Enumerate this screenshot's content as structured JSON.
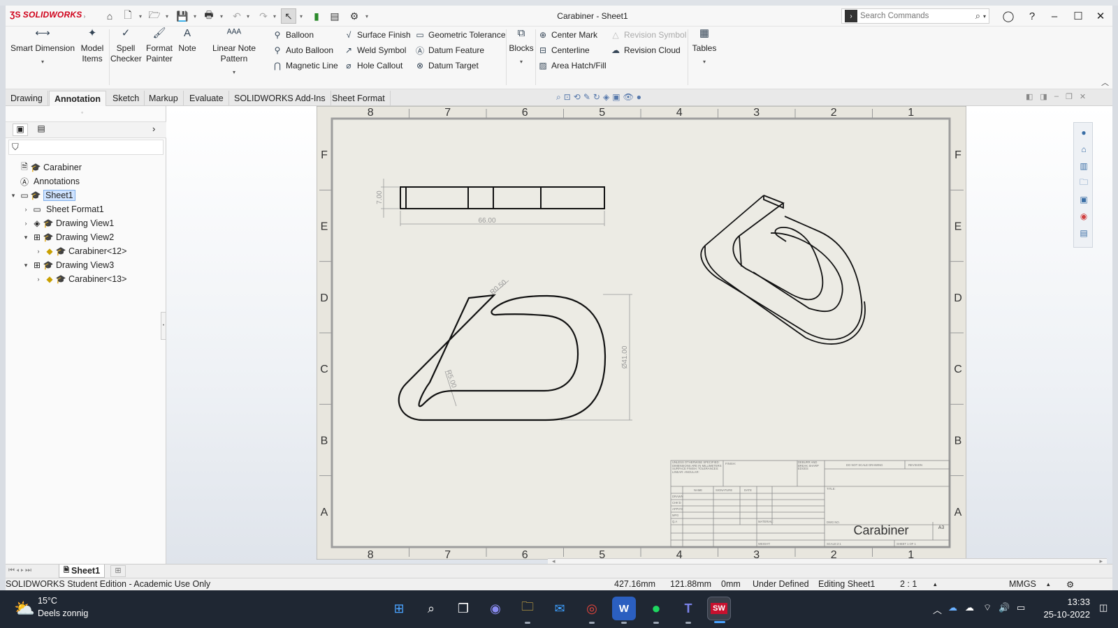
{
  "app": {
    "brand": "SOLIDWORKS",
    "document_title": "Carabiner - Sheet1",
    "accent_color": "#d0021b"
  },
  "search": {
    "placeholder": "Search Commands"
  },
  "ribbon": {
    "smart_dimension": "Smart Dimension",
    "model_items": "Model Items",
    "spell_checker": "Spell Checker",
    "format_painter": "Format Painter",
    "note": "Note",
    "linear_note_pattern": "Linear Note Pattern",
    "balloon": "Balloon",
    "auto_balloon": "Auto Balloon",
    "magnetic_line": "Magnetic Line",
    "surface_finish": "Surface Finish",
    "weld_symbol": "Weld Symbol",
    "hole_callout": "Hole Callout",
    "geometric_tolerance": "Geometric Tolerance",
    "datum_feature": "Datum Feature",
    "datum_target": "Datum Target",
    "blocks": "Blocks",
    "center_mark": "Center Mark",
    "centerline": "Centerline",
    "area_hatch": "Area Hatch/Fill",
    "revision_symbol": "Revision Symbol",
    "revision_cloud": "Revision Cloud",
    "tables": "Tables"
  },
  "tabs": [
    "Drawing",
    "Annotation",
    "Sketch",
    "Markup",
    "Evaluate",
    "SOLIDWORKS Add-Ins",
    "Sheet Format"
  ],
  "active_tab": "Annotation",
  "tree": {
    "root": "Carabiner",
    "annotations": "Annotations",
    "sheet1": "Sheet1",
    "sheet_format": "Sheet Format1",
    "view1": "Drawing View1",
    "view2": "Drawing View2",
    "view2_comp": "Carabiner<12>",
    "view3": "Drawing View3",
    "view3_comp": "Carabiner<13>"
  },
  "drawing": {
    "zone_numbers": [
      "8",
      "7",
      "6",
      "5",
      "4",
      "3",
      "2",
      "1"
    ],
    "zone_letters": [
      "F",
      "E",
      "D",
      "C",
      "B",
      "A"
    ],
    "dims": {
      "height": "7.00",
      "length": "66.00",
      "radius_top": "R0.50",
      "radius_inner": "R5.00",
      "diameter": "Ø41.00"
    },
    "title_block": {
      "title": "Carabiner",
      "size": "A3",
      "notes": "UNLESS OTHERWISE SPECIFIED: DIMENSIONS ARE IN MILLIMETERS SURFACE FINISH: TOLERANCES: LINEAR: ANGULAR:",
      "finish": "FINISH:",
      "deburr": "DEBURR AND BREAK SHARP EDGES",
      "do_not_scale": "DO NOT SCALE DRAWING",
      "revision": "REVISION",
      "name": "NAME",
      "signature": "SIGNATURE",
      "date": "DATE",
      "drawn": "DRAWN",
      "chkd": "CHK'D",
      "appvd": "APPV'D",
      "mfg": "MFG",
      "qa": "Q.A",
      "material": "MATERIAL:",
      "weight": "WEIGHT:",
      "title_label": "TITLE:",
      "dwg_no": "DWG NO.",
      "scale": "SCALE:2:1",
      "sheet": "SHEET 1 OF 1"
    }
  },
  "sheet_tabs": {
    "active": "Sheet1"
  },
  "status": {
    "edition": "SOLIDWORKS Student Edition - Academic Use Only",
    "x": "427.16mm",
    "y": "121.88mm",
    "z": "0mm",
    "state": "Under Defined",
    "editing": "Editing Sheet1",
    "scale": "2 : 1",
    "units": "MMGS"
  },
  "taskbar": {
    "temperature": "15°C",
    "weather": "Deels zonnig",
    "time": "13:33",
    "date": "25-10-2022"
  }
}
